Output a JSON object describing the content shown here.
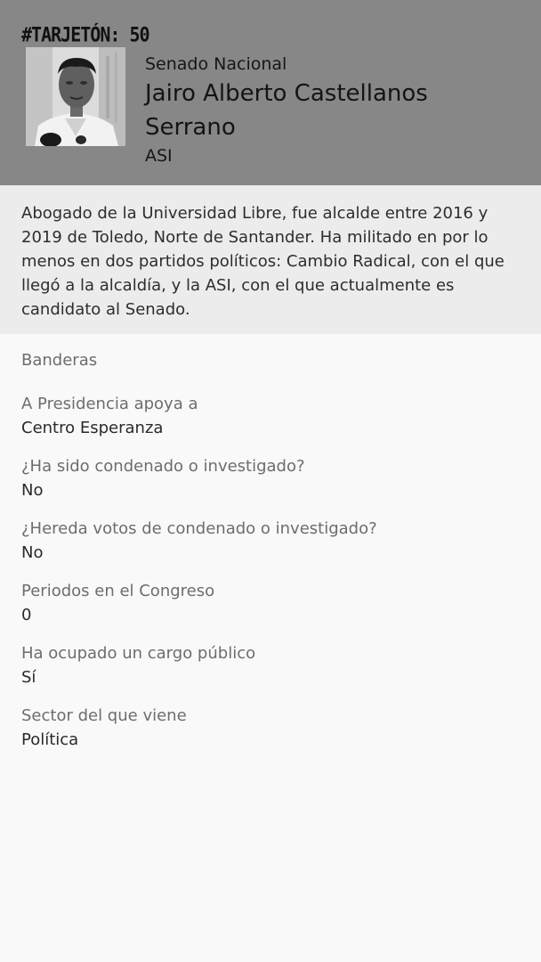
{
  "header": {
    "tag": "#TARJETÓN: 50",
    "chamber": "Senado Nacional",
    "candidate_name": "Jairo Alberto Castellanos Serrano",
    "party": "ASI",
    "photo": "candidate-portrait"
  },
  "bio": "Abogado de la Universidad Libre, fue alcalde entre 2016 y 2019 de Toledo, Norte de Santander. Ha militado en por lo menos en dos partidos políticos: Cambio Radical, con el que llegó a la alcaldía, y la ASI, con el que actualmente es candidato al Senado.",
  "flags": {
    "title": "Banderas",
    "items": [
      {
        "label": "A Presidencia apoya a",
        "value": "Centro Esperanza"
      },
      {
        "label": "¿Ha sido condenado o investigado?",
        "value": "No"
      },
      {
        "label": "¿Hereda votos de condenado o investigado?",
        "value": "No"
      },
      {
        "label": "Periodos en el Congreso",
        "value": "0"
      },
      {
        "label": "Ha ocupado un cargo público",
        "value": "Sí"
      },
      {
        "label": "Sector del que viene",
        "value": "Política"
      }
    ]
  },
  "colors": {
    "header_bg": "#878787",
    "bio_bg": "#ececec",
    "page_bg": "#f9f9f9"
  }
}
